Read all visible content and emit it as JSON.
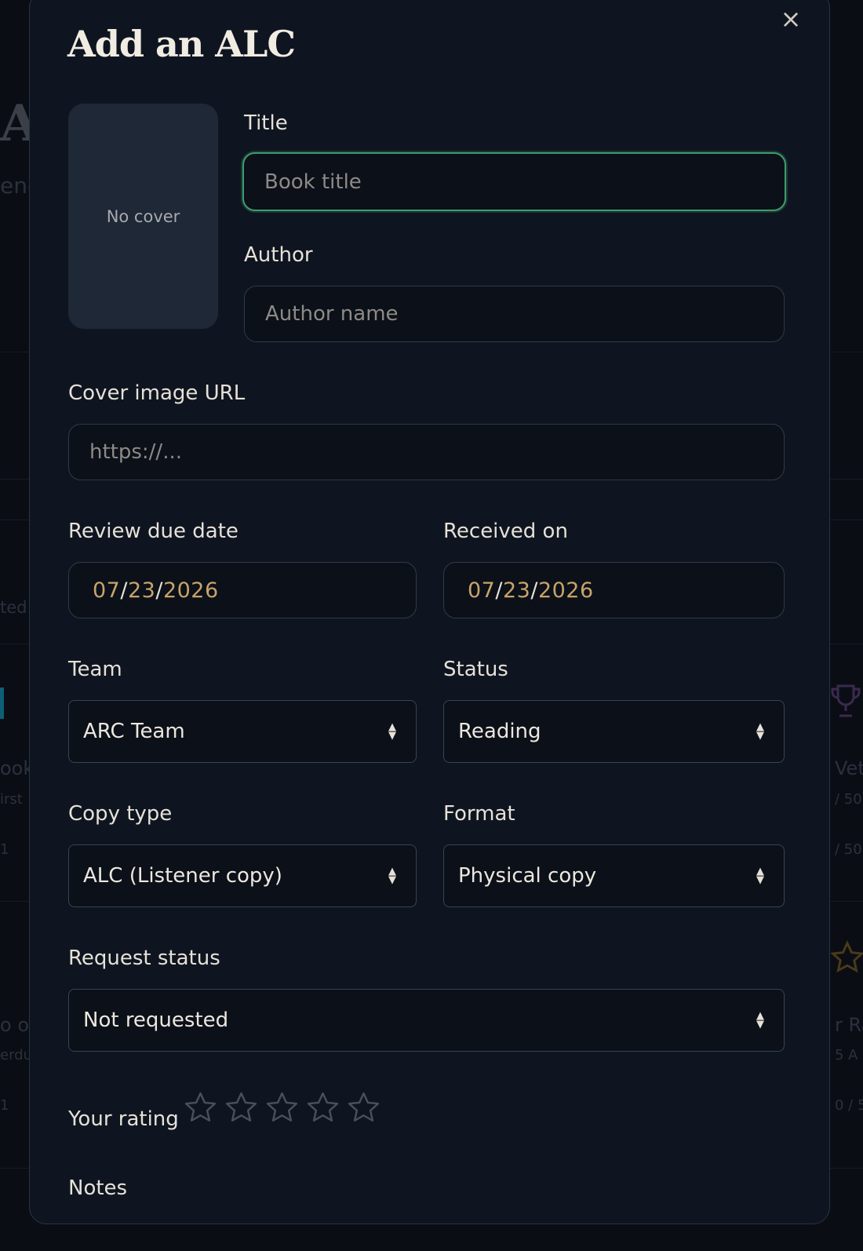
{
  "background": {
    "fragments": [
      "A",
      "ene",
      "ted",
      "ook",
      "irst",
      "1",
      "o of",
      "erdu",
      "1",
      "Vet",
      "/ 50",
      "/ 50",
      "r Ra",
      "5 A",
      "0 / 5"
    ]
  },
  "modal": {
    "title": "Add an ALC",
    "close_icon": "close-icon",
    "cover_placeholder": "No cover",
    "title_field": {
      "label": "Title",
      "placeholder": "Book title",
      "value": ""
    },
    "author_field": {
      "label": "Author",
      "placeholder": "Author name",
      "value": ""
    },
    "cover_url_field": {
      "label": "Cover image URL",
      "placeholder": "https://...",
      "value": ""
    },
    "review_due": {
      "label": "Review due date",
      "month": "07",
      "day": "23",
      "year": "2026",
      "sep": "/"
    },
    "received_on": {
      "label": "Received on",
      "month": "07",
      "day": "23",
      "year": "2026",
      "sep": "/"
    },
    "team": {
      "label": "Team",
      "value": "ARC Team"
    },
    "status": {
      "label": "Status",
      "value": "Reading"
    },
    "copy_type": {
      "label": "Copy type",
      "value": "ALC (Listener copy)"
    },
    "format": {
      "label": "Format",
      "value": "Physical copy"
    },
    "request_status": {
      "label": "Request status",
      "value": "Not requested"
    },
    "rating": {
      "label": "Your rating",
      "max": 5,
      "value": 0,
      "icon": "star-outline-icon"
    },
    "notes": {
      "label": "Notes"
    }
  },
  "colors": {
    "accent_focus": "#3e9c6c",
    "date_text": "#c8a36a",
    "panel": "#0f1520"
  }
}
